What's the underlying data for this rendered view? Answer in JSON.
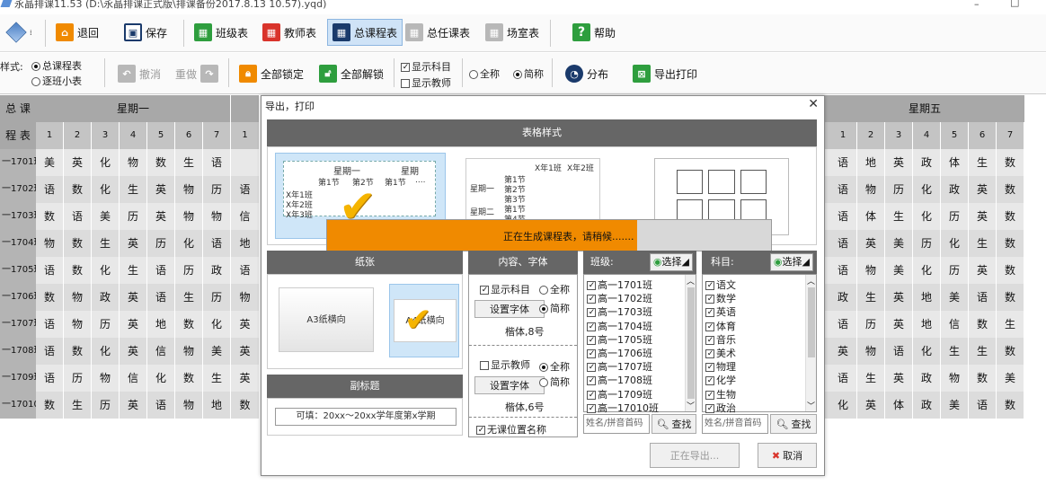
{
  "window": {
    "title": "永晶排课11.53   (D:\\永晶排课正式版\\排课备份2017.8.13  10.57).yqd)"
  },
  "toolbar": {
    "back": "退回",
    "save": "保存",
    "class_table": "班级表",
    "teacher_table": "教师表",
    "master_table": "总课程表",
    "head_teacher_table": "总任课表",
    "room_table": "场室表",
    "help": "帮助"
  },
  "toolbar2": {
    "style_label": "样式:",
    "style_master": "总课程表",
    "style_class_small": "逐班小表",
    "undo": "撤消",
    "redo": "重做",
    "lock_all": "全部锁定",
    "unlock_all": "全部解锁",
    "show_subject": "显示科目",
    "show_teacher": "显示教师",
    "full_name": "全称",
    "short_name": "简称",
    "distribute": "分布",
    "export_print": "导出打印"
  },
  "grid": {
    "corner_top": "总 课",
    "corner_bottom": "程 表",
    "day1": "星期一",
    "day5": "星期五",
    "periods": [
      "1",
      "2",
      "3",
      "4",
      "5",
      "6",
      "7"
    ],
    "period_extra": "1",
    "rows": [
      {
        "name": "一1701班",
        "left": [
          "美",
          "英",
          "化",
          "物",
          "数",
          "生",
          "语"
        ],
        "extra": "",
        "right": [
          "语",
          "地",
          "英",
          "政",
          "体",
          "生",
          "数"
        ]
      },
      {
        "name": "一1702班",
        "left": [
          "语",
          "数",
          "化",
          "生",
          "英",
          "物",
          "历"
        ],
        "extra": "语",
        "right": [
          "语",
          "物",
          "历",
          "化",
          "政",
          "英",
          "数"
        ]
      },
      {
        "name": "一1703班",
        "left": [
          "数",
          "语",
          "美",
          "历",
          "英",
          "物",
          "物"
        ],
        "extra": "信",
        "right": [
          "语",
          "体",
          "生",
          "化",
          "历",
          "英",
          "数"
        ]
      },
      {
        "name": "一1704班",
        "left": [
          "物",
          "数",
          "生",
          "英",
          "历",
          "化",
          "语"
        ],
        "extra": "地",
        "right": [
          "语",
          "英",
          "美",
          "历",
          "化",
          "生",
          "数"
        ]
      },
      {
        "name": "一1705班",
        "left": [
          "语",
          "数",
          "化",
          "生",
          "语",
          "历",
          "政"
        ],
        "extra": "语",
        "right": [
          "语",
          "物",
          "美",
          "化",
          "历",
          "英",
          "数"
        ]
      },
      {
        "name": "一1706班",
        "left": [
          "数",
          "物",
          "政",
          "英",
          "语",
          "生",
          "历"
        ],
        "extra": "物",
        "right": [
          "政",
          "生",
          "英",
          "地",
          "美",
          "语",
          "数"
        ]
      },
      {
        "name": "一1707班",
        "left": [
          "语",
          "物",
          "历",
          "英",
          "地",
          "数",
          "化"
        ],
        "extra": "英",
        "right": [
          "语",
          "历",
          "英",
          "地",
          "信",
          "数",
          "生"
        ]
      },
      {
        "name": "一1708班",
        "left": [
          "语",
          "数",
          "化",
          "英",
          "信",
          "物",
          "美"
        ],
        "extra": "英",
        "right": [
          "英",
          "物",
          "语",
          "化",
          "生",
          "生",
          "数"
        ]
      },
      {
        "name": "一1709班",
        "left": [
          "语",
          "历",
          "物",
          "信",
          "化",
          "数",
          "生"
        ],
        "extra": "英",
        "right": [
          "语",
          "生",
          "英",
          "政",
          "物",
          "数",
          "美"
        ]
      },
      {
        "name": "一17010班",
        "left": [
          "数",
          "生",
          "历",
          "英",
          "语",
          "物",
          "地"
        ],
        "extra": "数",
        "right": [
          "化",
          "英",
          "体",
          "政",
          "美",
          "语",
          "数"
        ]
      }
    ]
  },
  "dialog": {
    "title": "导出，打印",
    "table_style": "表格样式",
    "preview1": {
      "day1": "星期一",
      "day2": "星期",
      "p1": "第1节",
      "p2": "第2节",
      "p3": "第1节",
      "dots": "....",
      "c1": "X年1班",
      "c2": "X年2班",
      "c3": "X年3班"
    },
    "preview2": {
      "c1": "X年1班",
      "c2": "X年2班",
      "d1": "星期一",
      "d2": "星期二",
      "p1": "第1节",
      "p2": "第2节",
      "p3": "第3节",
      "p4": "第4节",
      "p5": "第1节"
    },
    "progress_text": "正在生成课程表，请稍候.......",
    "paper": "纸张",
    "paper_a3": "A3纸横向",
    "paper_a4": "A4纸横向",
    "subtitle_head": "副标题",
    "subtitle_placeholder": "可填：20xx～20xx学年度第x学期",
    "content_font": "内容、字体",
    "show_subject": "显示科目",
    "full": "全称",
    "short": "简称",
    "set_font": "设置字体",
    "font1": "楷体,8号",
    "show_teacher": "显示教师",
    "font2": "楷体,6号",
    "no_class_pos": "无课位置名称",
    "class_label": "班级:",
    "select": "选择",
    "classes": [
      "高一1701班",
      "高一1702班",
      "高一1703班",
      "高一1704班",
      "高一1705班",
      "高一1706班",
      "高一1707班",
      "高一1708班",
      "高一1709班",
      "高一17010班"
    ],
    "subject_label": "科目:",
    "subjects": [
      "语文",
      "数学",
      "英语",
      "体育",
      "音乐",
      "美术",
      "物理",
      "化学",
      "生物",
      "政治"
    ],
    "search_placeholder": "姓名/拼音首码",
    "search": "查找",
    "exporting": "正在导出...",
    "cancel": "取消"
  },
  "colors": {
    "accent_orange": "#f08a00",
    "grid_header": "#a8a8a8",
    "panel_head": "#666666",
    "active_button": "#cfe3f7"
  }
}
